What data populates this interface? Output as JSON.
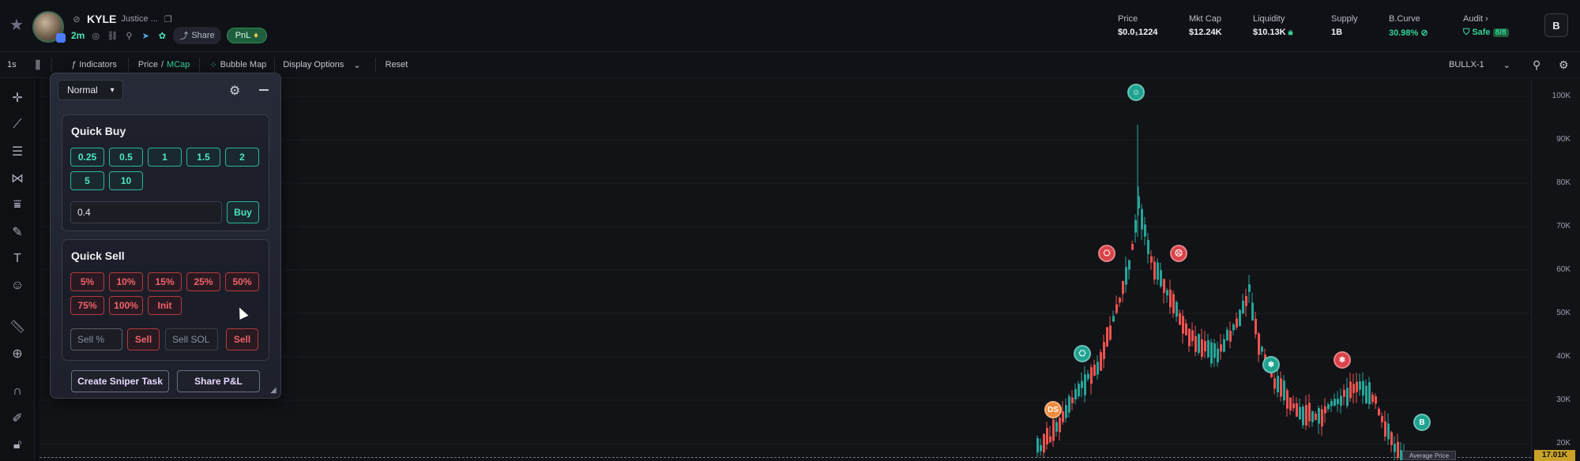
{
  "header": {
    "token_ticker": "KYLE",
    "token_name": "Justice ...",
    "age": "2m",
    "share_label": "Share",
    "pnl_label": "PnL",
    "stats": [
      {
        "label": "Price",
        "value": "$0.0₁1224",
        "green": false
      },
      {
        "label": "Mkt Cap",
        "value": "$12.24K",
        "green": false
      },
      {
        "label": "Liquidity",
        "value": "$10.13K",
        "green": false
      },
      {
        "label": "Supply",
        "value": "1B",
        "green": false
      },
      {
        "label": "B.Curve",
        "value": "30.98%",
        "green": true
      },
      {
        "label": "Audit",
        "value": "Safe",
        "green": true
      }
    ],
    "audit_count": "8/8",
    "account_initial": "B"
  },
  "toolbar": {
    "interval": "1s",
    "indicators": "Indicators",
    "price_label": "Price",
    "slash": "/",
    "mcap_label": "MCap",
    "bubble_map": "Bubble Map",
    "display_options": "Display Options",
    "reset": "Reset",
    "platform": "BULLX-1"
  },
  "yaxis": {
    "ticks": [
      "100K",
      "90K",
      "80K",
      "70K",
      "60K",
      "50K",
      "40K",
      "30K",
      "20K"
    ],
    "current_price": "17.01K",
    "average_price_label": "Average Price"
  },
  "panel": {
    "mode": "Normal",
    "quick_buy": {
      "title": "Quick Buy",
      "amounts": [
        "0.25",
        "0.5",
        "1",
        "1.5",
        "2",
        "5",
        "10"
      ],
      "input_value": "0.4",
      "buy_label": "Buy"
    },
    "quick_sell": {
      "title": "Quick Sell",
      "percents": [
        "5%",
        "10%",
        "15%",
        "25%",
        "50%",
        "75%",
        "100%",
        "Init"
      ],
      "sell_percent_placeholder": "Sell %",
      "sell_label": "Sell",
      "sell_sol_placeholder": "Sell SOL",
      "sell_sol_label": "Sell"
    },
    "create_sniper_task": "Create Sniper Task",
    "share_pnl": "Share P&L"
  },
  "chart_markers": [
    {
      "text": "DS",
      "color": "#f08a3c"
    },
    {
      "text": "B",
      "color": "#1fa391"
    }
  ],
  "colors": {
    "up": "#26a69a",
    "down": "#ef5350",
    "accent_green": "#34d399"
  }
}
